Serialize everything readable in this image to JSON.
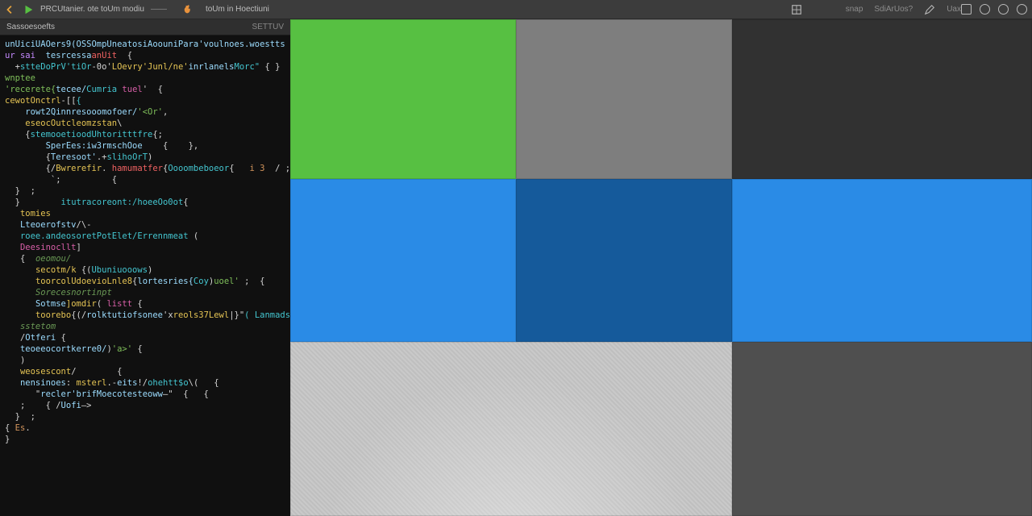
{
  "toolbar": {
    "left": {
      "back_icon": "arrow-left",
      "play_icon": "play",
      "title": "PRCUtanier.  ote  toUm  modiu",
      "mode_label": "——"
    },
    "center": {
      "flame_icon": "flame",
      "location": "toUm  in   Hoectiuni",
      "dropdown_icon": "chevron-down"
    },
    "right": {
      "snap_label": "snap",
      "grid_label": "SdiArUos?",
      "tool1_icon": "pencil",
      "tool1_label": "Uax",
      "panel_icon": "panel",
      "ring1_icon": "ring",
      "ring2_icon": "ring",
      "ring3_icon": "ring"
    }
  },
  "editor": {
    "tab_label": "Sassoesoefts",
    "tab_status": "SETTUV",
    "code_lines": [
      [
        [
          "var",
          "unUiciUAOers9(OSSOmpUneatosiAoouniPara'voulnoes.woestts"
        ]
      ],
      [
        [
          "kw",
          "ur sai  "
        ],
        [
          "var",
          "tesrcessa"
        ],
        [
          "err",
          "anUit"
        ],
        [
          "op",
          "  {"
        ]
      ],
      [
        [
          "op",
          "  +"
        ],
        [
          "type",
          "stteDoPrV'tiOr"
        ],
        [
          "op",
          "-0o'"
        ],
        [
          "fn",
          "LOevry'Junl/ne'"
        ],
        [
          "var",
          "inrlanels"
        ],
        [
          "type",
          "Morc\""
        ],
        [
          "op",
          " { }"
        ]
      ],
      [
        [
          "str",
          "wnptee"
        ]
      ],
      [
        [
          "str",
          "'recerete{"
        ],
        [
          "var",
          "tecee/"
        ],
        [
          "type",
          "Cumria "
        ],
        [
          "mag",
          "tuel"
        ],
        [
          "op",
          "'  {"
        ]
      ],
      [
        [
          "fn",
          "cewotOnctrl"
        ],
        [
          "op",
          "-[["
        ],
        [
          "type",
          "{"
        ]
      ],
      [
        [
          "op",
          "    "
        ],
        [
          "var",
          "rowt2Qinnresooomofoer/"
        ],
        [
          "str",
          "'<Or'"
        ],
        [
          "op",
          ","
        ]
      ],
      [
        [
          "op",
          "    "
        ],
        [
          "fn",
          "eseocOutcleomzstan"
        ],
        [
          "op",
          "\\"
        ]
      ],
      [
        [
          "op",
          "    {"
        ],
        [
          "type",
          "stemooetioodUhtoritttfre"
        ],
        [
          "op",
          "{;"
        ]
      ],
      [
        [
          "op",
          "        "
        ],
        [
          "var",
          "SperEes:iw3rmschOoe"
        ],
        [
          "op",
          "    {    },"
        ]
      ],
      [
        [
          "op",
          "        {"
        ],
        [
          "var",
          "Teresoot'"
        ],
        [
          "op",
          ".+"
        ],
        [
          "type",
          "slihoOrT"
        ],
        [
          "op",
          ")"
        ]
      ],
      [
        [
          "op",
          "        {/"
        ],
        [
          "fn",
          "Bwrerefir"
        ],
        [
          "op",
          ". "
        ],
        [
          "err",
          "hamumatfer"
        ],
        [
          "op",
          "{"
        ],
        [
          "type",
          "Oooombeboeor"
        ],
        [
          "op",
          "{   "
        ],
        [
          "num",
          "i 3"
        ],
        [
          "op",
          "  / ;"
        ]
      ],
      [
        [
          "op",
          "         `;          {"
        ]
      ],
      [
        [
          "op",
          "  }  ;"
        ]
      ],
      [
        [
          "op",
          "  }        "
        ],
        [
          "type",
          "itutracoreont:/hoeeOo0ot"
        ],
        [
          "op",
          "{"
        ]
      ],
      [
        [
          "op",
          "   "
        ],
        [
          "fn",
          "tomies"
        ]
      ],
      [
        [
          "op",
          "   "
        ],
        [
          "var",
          "Lteoerofstv"
        ],
        [
          "op",
          "/\\-"
        ]
      ],
      [
        [
          "op",
          "   "
        ],
        [
          "type",
          "roee.andeosoretPotElet/Errennmeat"
        ],
        [
          "op",
          " ("
        ]
      ],
      [
        [
          "op",
          "   "
        ],
        [
          "mag",
          "Deesinocllt"
        ],
        [
          "op",
          "]"
        ]
      ],
      [
        [
          "op",
          "   {  "
        ],
        [
          "cmt",
          "oeomou/"
        ]
      ],
      [
        [
          "op",
          "      "
        ],
        [
          "fn",
          "secotm/k"
        ],
        [
          "op",
          " {("
        ],
        [
          "type",
          "Ubuniuooows"
        ],
        [
          "op",
          ")"
        ]
      ],
      [
        [
          "op",
          "      "
        ],
        [
          "fn",
          "toorcolUdoevioLnle8"
        ],
        [
          "op",
          "{"
        ],
        [
          "var",
          "lortesries{"
        ],
        [
          "type",
          "Coy"
        ],
        [
          "op",
          ")"
        ],
        [
          "str",
          "uoel'"
        ],
        [
          "op",
          " ;"
        ],
        [
          "op",
          "  {"
        ]
      ],
      [
        [
          "op",
          "      "
        ],
        [
          "cmt",
          "Sorecesnortinpt"
        ]
      ],
      [
        [
          "op",
          "      "
        ],
        [
          "var",
          "Sotmse"
        ],
        [
          "fn",
          "]omdir"
        ],
        [
          "op",
          "( "
        ],
        [
          "mag",
          "listt"
        ],
        [
          "op",
          " {"
        ]
      ],
      [
        [
          "op",
          "      "
        ],
        [
          "fn",
          "toorebo"
        ],
        [
          "op",
          "{(/"
        ],
        [
          "var",
          "rolktutiofsonee"
        ],
        [
          "op",
          "'x"
        ],
        [
          "fn",
          "reols37Lewl"
        ],
        [
          "op",
          "|}\""
        ],
        [
          "type",
          "( Lanmadser"
        ]
      ],
      [
        [
          "op",
          "   "
        ],
        [
          "cmt",
          "sstetom"
        ]
      ],
      [
        [
          "op",
          "   /"
        ],
        [
          "var",
          "Otferi"
        ],
        [
          "op",
          " {"
        ]
      ],
      [
        [
          "op",
          "   "
        ],
        [
          "var",
          "teoeeocortkerre0/"
        ],
        [
          "op",
          ")"
        ],
        [
          "str",
          "'a>'"
        ],
        [
          "op",
          " {"
        ]
      ],
      [
        [
          "op",
          "   )"
        ]
      ],
      [
        [
          "op",
          "   "
        ],
        [
          "fn",
          "weosescont"
        ],
        [
          "op",
          "/        {"
        ]
      ],
      [
        [
          "op",
          "   "
        ],
        [
          "var",
          "nensinoes"
        ],
        [
          "op",
          ": "
        ],
        [
          "fn",
          "msterl"
        ],
        [
          "op",
          ".-"
        ],
        [
          "var",
          "eits"
        ],
        [
          "op",
          "!/"
        ],
        [
          "type",
          "ohehtt$o"
        ],
        [
          "op",
          "\\(   {"
        ]
      ],
      [
        [
          "op",
          "      \""
        ],
        [
          "var",
          "recler'brifMoecotesteoww"
        ],
        [
          "op",
          "—\"  {   {"
        ]
      ],
      [
        [
          "op",
          "   ;    { /"
        ],
        [
          "var",
          "Uofi"
        ],
        [
          "op",
          "—>"
        ]
      ],
      [
        [
          "op",
          "  }  ;"
        ]
      ],
      [
        [
          "op",
          "{ "
        ],
        [
          "num",
          "Es"
        ],
        [
          "op",
          "."
        ]
      ],
      [
        [
          "op",
          "}"
        ]
      ]
    ]
  },
  "viewport": {
    "cells": [
      {
        "pos": "r1c1",
        "kind": "green"
      },
      {
        "pos": "r1c2",
        "kind": "gray-mid"
      },
      {
        "pos": "r1c3",
        "kind": "gray-dark"
      },
      {
        "pos": "r2c1",
        "kind": "blue-brt"
      },
      {
        "pos": "r2c2",
        "kind": "blue-dim"
      },
      {
        "pos": "r2c3",
        "kind": "blue-brt2"
      },
      {
        "pos": "r3c12",
        "kind": "floor"
      },
      {
        "pos": "r3c3",
        "kind": "gray-dark2"
      }
    ]
  }
}
